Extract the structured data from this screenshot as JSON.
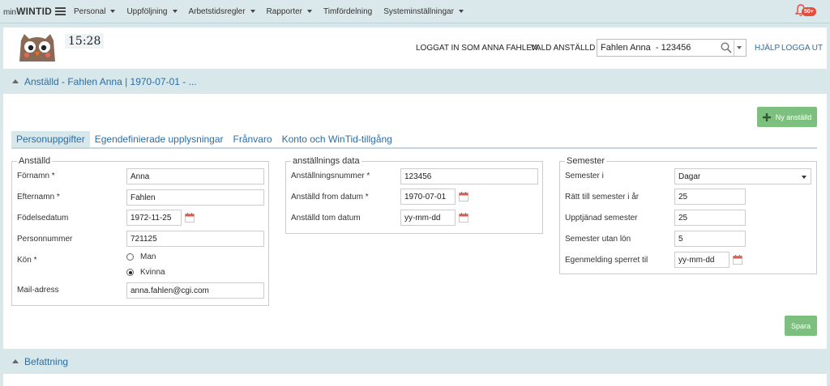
{
  "app": {
    "brand_prefix": "min",
    "brand_name": "WINTID"
  },
  "nav": {
    "items": [
      {
        "label": "Personal",
        "has_caret": true
      },
      {
        "label": "Uppföljning",
        "has_caret": true
      },
      {
        "label": "Arbetstidsregler",
        "has_caret": true
      },
      {
        "label": "Rapporter",
        "has_caret": true
      },
      {
        "label": "Timfördelning",
        "has_caret": false
      },
      {
        "label": "Systeminställningar",
        "has_caret": true
      }
    ],
    "notifications_badge": "50+"
  },
  "header": {
    "clock": "15:28",
    "logged_in": "LOGGAT IN SOM ANNA FAHLEN.",
    "selected_label": "VALD ANSTÄLLD",
    "search_value": "Fahlen Anna  - 123456",
    "help": "HJÄLP",
    "logout": "LOGGA UT"
  },
  "sections": {
    "employee_title": "Anställd - Fahlen Anna | 1970-07-01 - ...",
    "position_title": "Befattning"
  },
  "buttons": {
    "new_employee": "Ny anställd",
    "save": "Spara"
  },
  "tabs": [
    {
      "label": "Personuppgifter",
      "active": true
    },
    {
      "label": "Egendefinierade upplysningar",
      "active": false
    },
    {
      "label": "Frånvaro",
      "active": false
    },
    {
      "label": "Konto och WinTid-tillgång",
      "active": false
    }
  ],
  "employee": {
    "legend": "Anställd",
    "first_name_label": "Förnamn *",
    "first_name": "Anna",
    "last_name_label": "Efternamn *",
    "last_name": "Fahlen",
    "birthdate_label": "Födelsedatum",
    "birthdate": "1972-11-25",
    "personal_number_label": "Personnummer",
    "personal_number": "721125",
    "gender_label": "Kön *",
    "gender_male": "Man",
    "gender_female": "Kvinna",
    "gender_selected": "Kvinna",
    "email_label": "Mail-adress",
    "email": "anna.fahlen@cgi.com"
  },
  "employment": {
    "legend": "anställnings data",
    "number_label": "Anställningsnummer *",
    "number": "123456",
    "from_label": "Anställd from datum *",
    "from": "1970-07-01",
    "to_label": "Anställd tom datum",
    "to_placeholder": "yy-mm-dd"
  },
  "vacation": {
    "legend": "Semester",
    "unit_label": "Semester i",
    "unit": "Dagar",
    "entitled_label": "Rätt till semester i år",
    "entitled": "25",
    "earned_label": "Upptjänad semester",
    "earned": "25",
    "unpaid_label": "Semester utan lön",
    "unpaid": "5",
    "self_report_label": "Egenmelding sperret til",
    "self_report_placeholder": "yy-mm-dd"
  },
  "colors": {
    "accent": "#2a6ea6",
    "bar": "#d7e7ea",
    "green": "#7dbf7e",
    "badge": "#e74c3c"
  }
}
